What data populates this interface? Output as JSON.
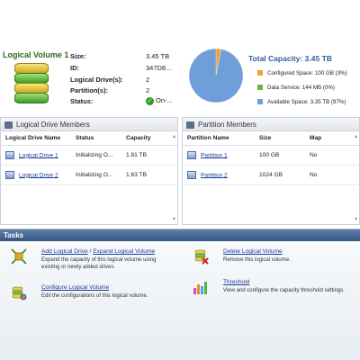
{
  "volume": {
    "title": "Logical Volume 1",
    "size_label": "Size:",
    "size_value": "3.45 TB",
    "id_label": "ID:",
    "id_value": "347D8...",
    "drives_label": "Logical Drive(s):",
    "drives_value": "2",
    "partitions_label": "Partition(s):",
    "partitions_value": "2",
    "status_label": "Status:",
    "status_value": "On-..."
  },
  "capacity": {
    "title": "Total Capacity: 3.45 TB",
    "legend": [
      {
        "label": "Configured Space: 100 GB (3%)",
        "color": "#f0a030"
      },
      {
        "label": "Data Service: 144 MB (0%)",
        "color": "#6cb33e"
      },
      {
        "label": "Available Space: 3.35 TB (97%)",
        "color": "#6f9fd8"
      }
    ]
  },
  "chart_data": {
    "type": "pie",
    "slices": [
      {
        "label": "Configured Space",
        "value": 3,
        "color": "#f0a030"
      },
      {
        "label": "Data Service",
        "value": 0.004,
        "color": "#6cb33e"
      },
      {
        "label": "Available Space",
        "value": 97,
        "color": "#6f9fd8"
      }
    ]
  },
  "drives_panel": {
    "title": "Logical Drive Members",
    "columns": [
      "Logical Drive Name",
      "Status",
      "Capacity"
    ],
    "rows": [
      {
        "name": "Logical Drive 1",
        "status": "Initializing O...",
        "capacity": "1.81 TB"
      },
      {
        "name": "Logical Drive 2",
        "status": "Initializing O...",
        "capacity": "1.63 TB"
      }
    ]
  },
  "partitions_panel": {
    "title": "Partition Members",
    "columns": [
      "Partition Name",
      "Size",
      "Map"
    ],
    "rows": [
      {
        "name": "Partition 1",
        "size": "100 GB",
        "map": "No"
      },
      {
        "name": "Partition 2",
        "size": "1024 GB",
        "map": "No"
      }
    ]
  },
  "tasks": {
    "header": "Tasks",
    "add_drive_link": "Add Logical Drive",
    "separator": " / ",
    "expand_link": "Expand Logical Volume",
    "add_desc_1": "Expand the capacity of this logical volume using",
    "add_desc_2": "existing or newly added drives.",
    "configure_link": "Configure Logical Volume",
    "configure_desc": "Edit the configurations of this logical volume.",
    "delete_link": "Delete Logical Volume",
    "delete_desc": "Remove this logical volume.",
    "threshold_link": "Threshold",
    "threshold_desc": "View and configure the capacity threshold settings."
  }
}
